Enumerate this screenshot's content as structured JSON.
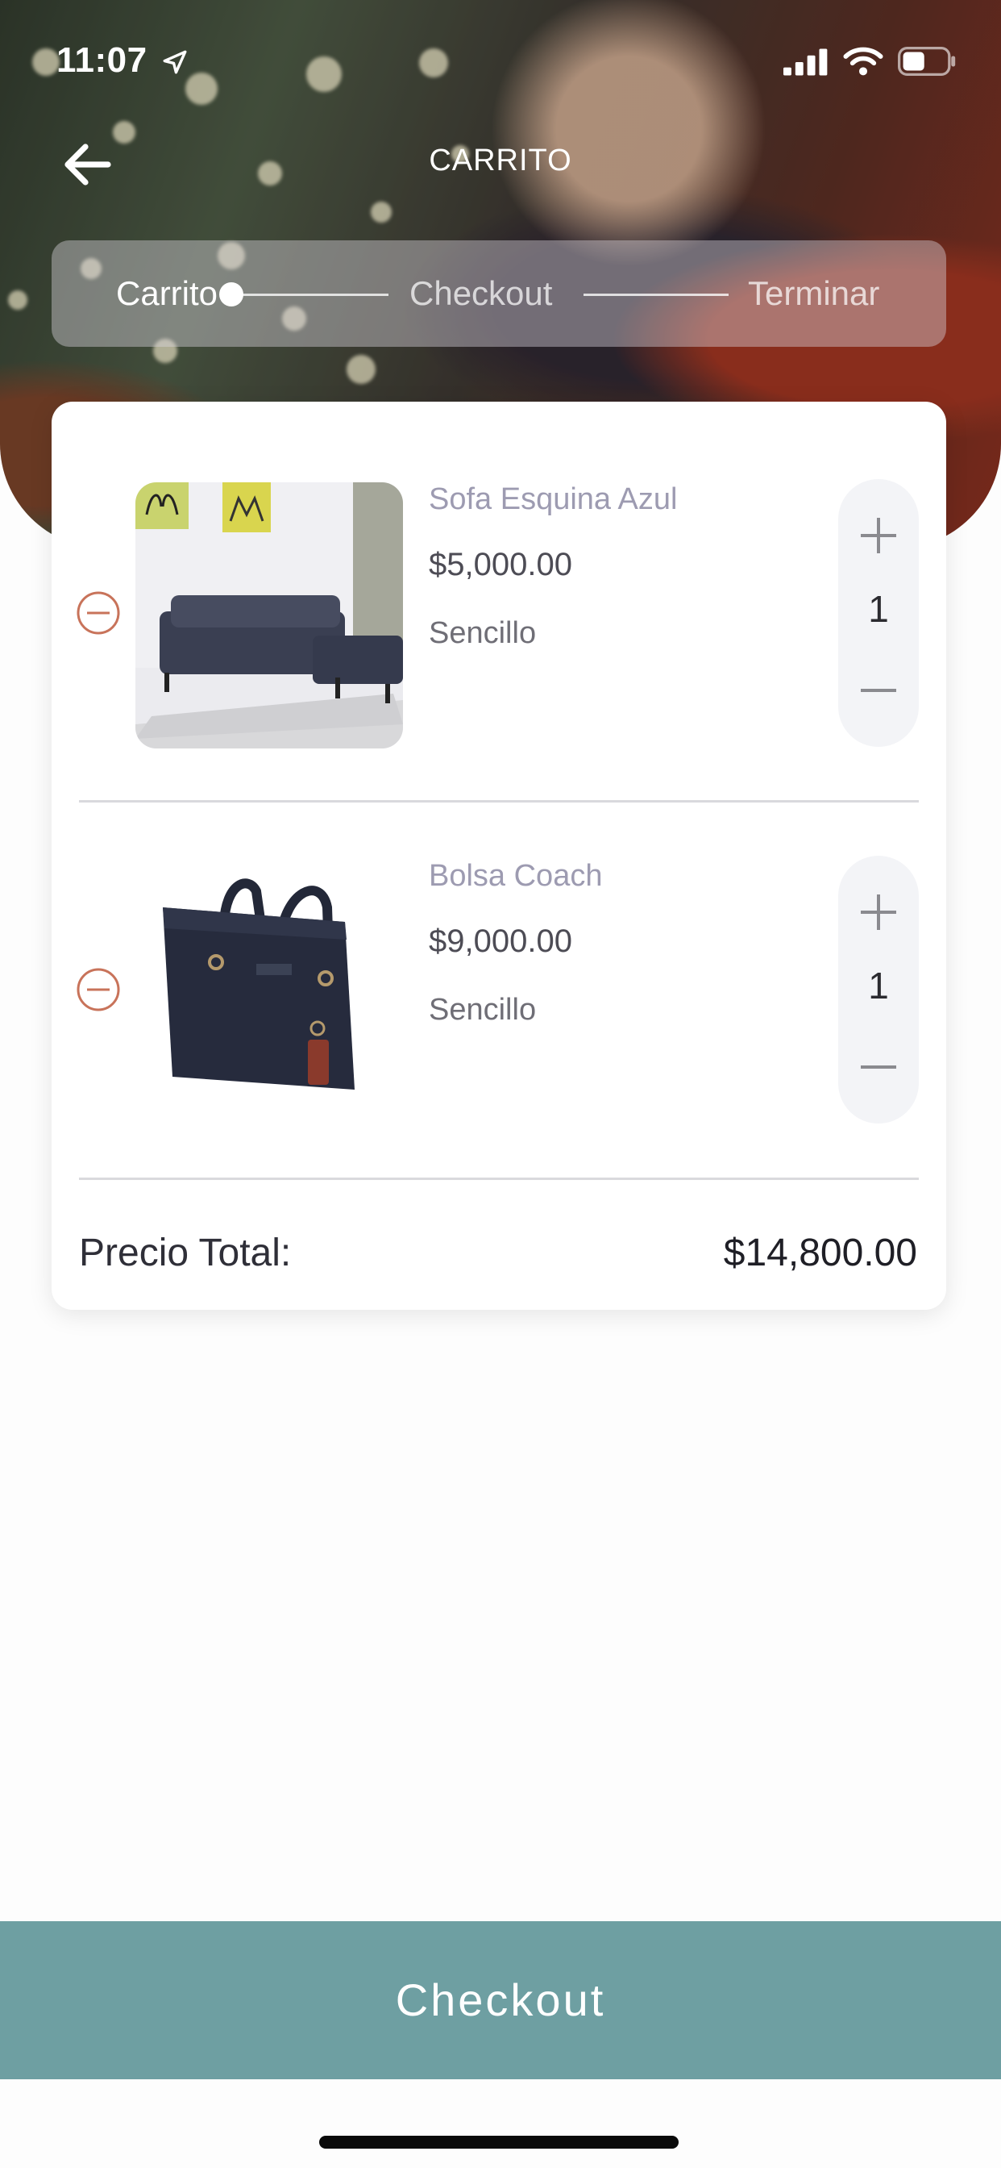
{
  "status_bar": {
    "time": "11:07",
    "icons": [
      "location-arrow-icon",
      "cellular-signal-icon",
      "wifi-icon",
      "battery-icon"
    ]
  },
  "header": {
    "title": "CARRITO",
    "back_icon": "arrow-left-icon"
  },
  "steps": [
    {
      "label": "Carrito",
      "active": true
    },
    {
      "label": "Checkout",
      "active": false
    },
    {
      "label": "Terminar",
      "active": false
    }
  ],
  "cart": {
    "items": [
      {
        "name": "Sofa Esquina Azul",
        "price": "$5,000.00",
        "variant": "Sencillo",
        "quantity": "1",
        "image": "navy sectional sofa in living room"
      },
      {
        "name": "Bolsa Coach",
        "price": "$9,000.00",
        "variant": "Sencillo",
        "quantity": "1",
        "image": "navy leather handbag"
      }
    ],
    "total_label": "Precio Total:",
    "total_value": "$14,800.00"
  },
  "checkout_button": {
    "label": "Checkout"
  },
  "colors": {
    "accent": "#6e9fa2",
    "remove": "#c8735a",
    "product_name": "#9d9bb1"
  }
}
